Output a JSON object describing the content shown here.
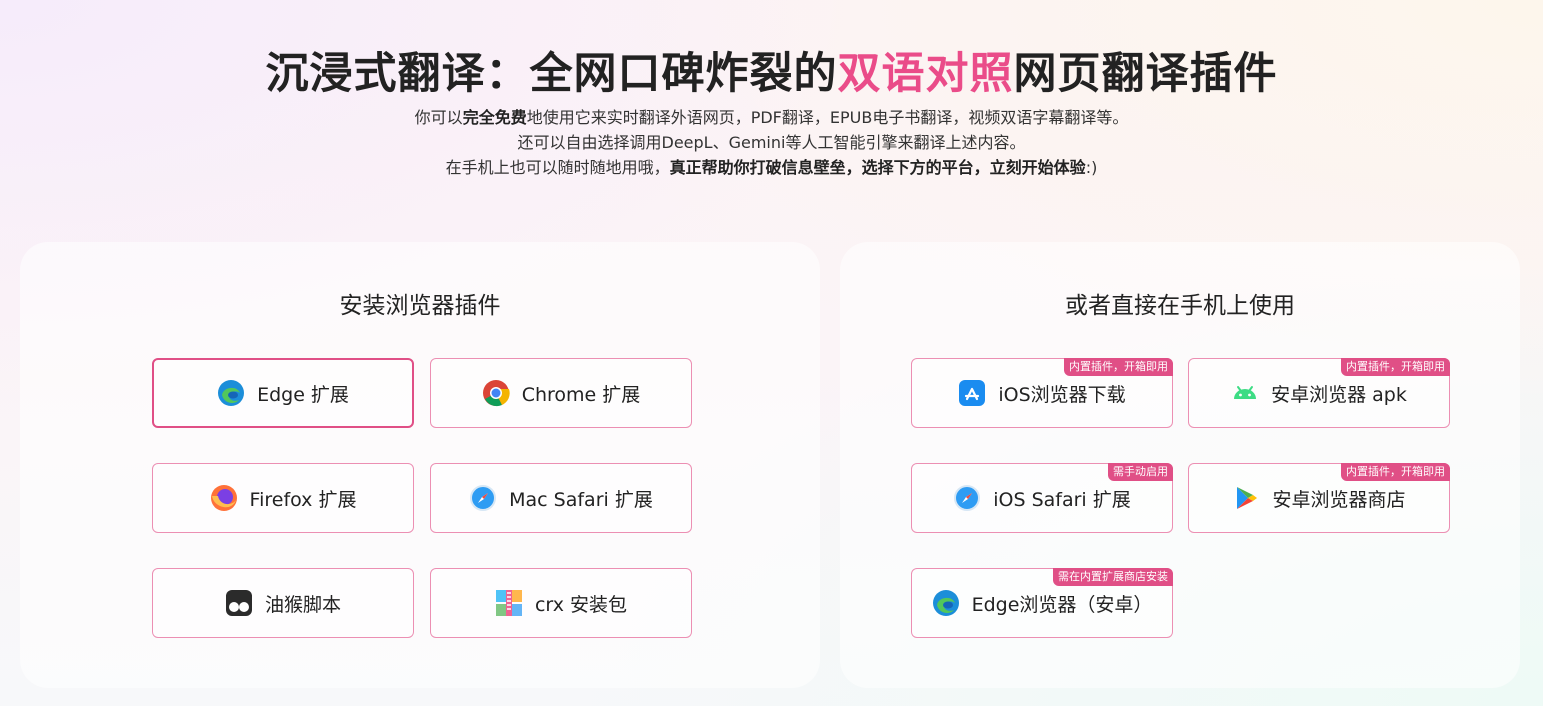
{
  "hero": {
    "title_pre": "沉浸式翻译：全网口碑炸裂的",
    "title_highlight": "双语对照",
    "title_post": "网页翻译插件",
    "line1_pre": "你可以",
    "line1_bold": "完全免费",
    "line1_post": "地使用它来实时翻译外语网页，PDF翻译，EPUB电子书翻译，视频双语字幕翻译等。",
    "line2": "还可以自由选择调用DeepL、Gemini等人工智能引擎来翻译上述内容。",
    "line3_pre": "在手机上也可以随时随地用哦，",
    "line3_bold": "真正帮助你打破信息壁垒，选择下方的平台，立刻开始体验",
    "line3_post": ":)"
  },
  "extensions": {
    "title": "安装浏览器插件",
    "buttons": [
      {
        "label": "Edge 扩展",
        "icon": "edge-icon"
      },
      {
        "label": "Chrome 扩展",
        "icon": "chrome-icon"
      },
      {
        "label": "Firefox 扩展",
        "icon": "firefox-icon"
      },
      {
        "label": "Mac Safari 扩展",
        "icon": "safari-icon"
      },
      {
        "label": "油猴脚本",
        "icon": "tampermonkey-icon"
      },
      {
        "label": "crx 安装包",
        "icon": "zip-icon"
      }
    ]
  },
  "mobile": {
    "title": "或者直接在手机上使用",
    "buttons": [
      {
        "label": "iOS浏览器下载",
        "icon": "app-store-icon",
        "badge": "内置插件，开箱即用"
      },
      {
        "label": "安卓浏览器 apk",
        "icon": "android-icon",
        "badge": "内置插件，开箱即用"
      },
      {
        "label": "iOS Safari 扩展",
        "icon": "safari-icon",
        "badge": "需手动启用"
      },
      {
        "label": "安卓浏览器商店",
        "icon": "google-play-icon",
        "badge": "内置插件，开箱即用"
      },
      {
        "label": "Edge浏览器（安卓）",
        "icon": "edge-icon",
        "badge": "需在内置扩展商店安装"
      }
    ]
  },
  "colors": {
    "accent": "#e04f86",
    "highlight": "#ea4c89",
    "border": "#ec8fb3"
  }
}
